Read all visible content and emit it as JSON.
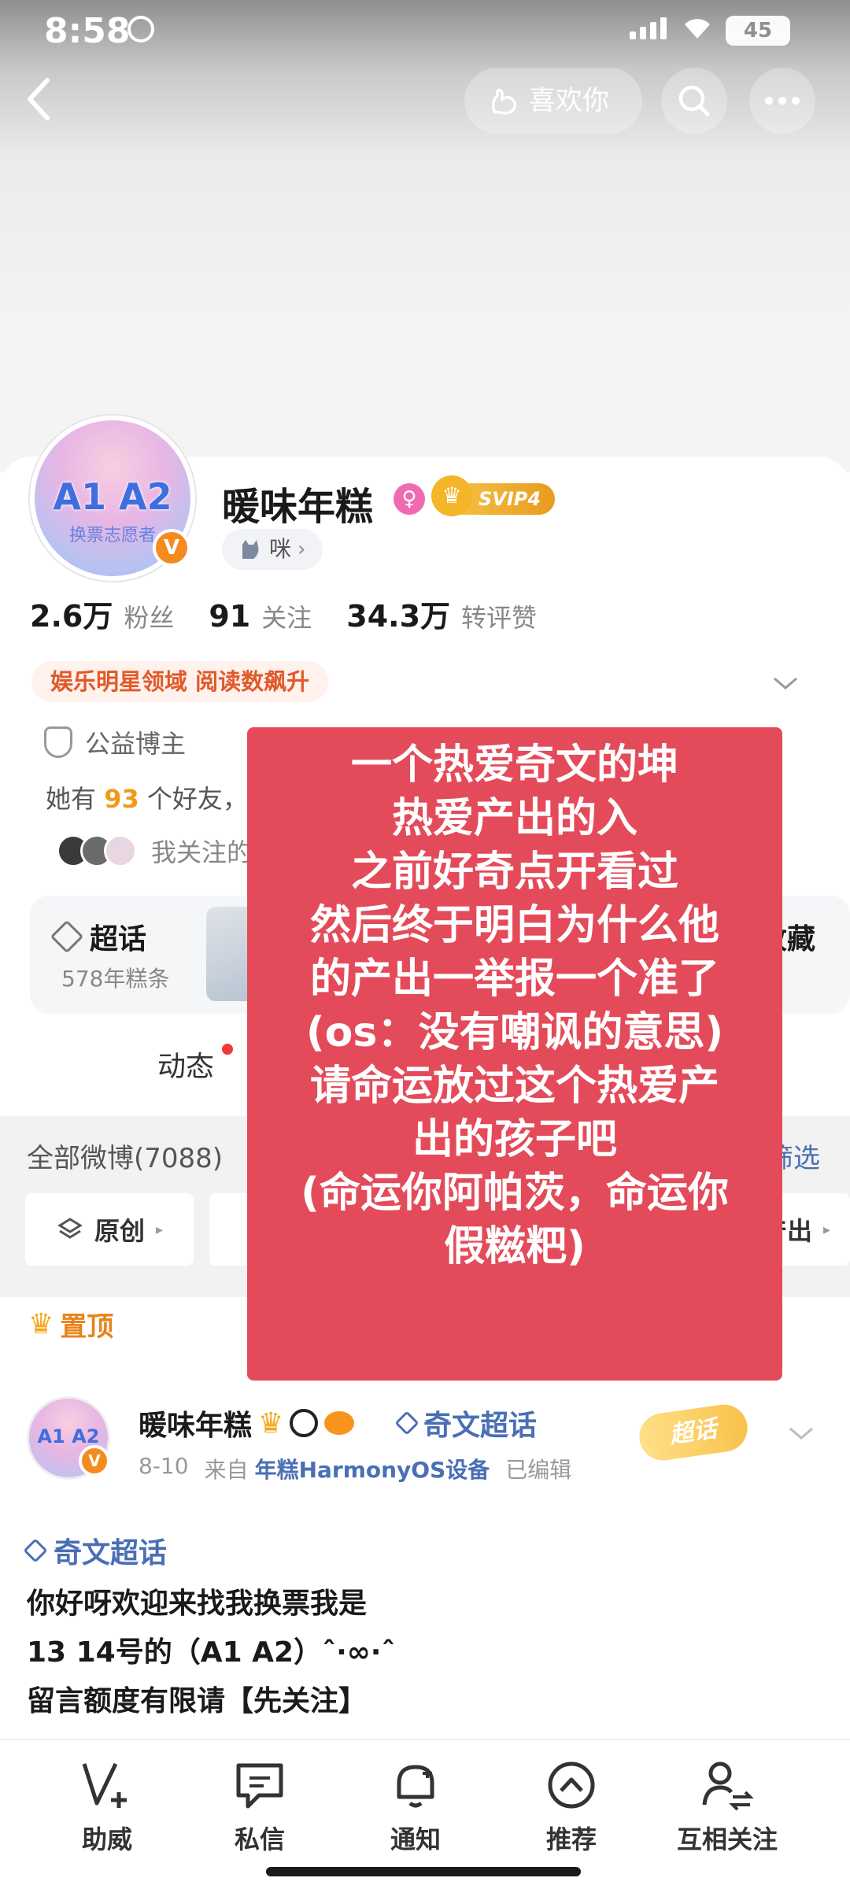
{
  "status": {
    "time": "8:58",
    "battery": "45"
  },
  "header": {
    "like_label": "喜欢你"
  },
  "profile": {
    "avatar_text": "A1 A2",
    "avatar_sub": "换票志愿者",
    "name": "暖味年糕",
    "svip": "SVIP4",
    "mimi": "咪",
    "stats": [
      {
        "num": "2.6万",
        "label": "粉丝"
      },
      {
        "num": "91",
        "label": "关注"
      },
      {
        "num": "34.3万",
        "label": "转评赞"
      }
    ],
    "tag": "娱乐明星领域 阅读数飙升",
    "public_label": "公益博主",
    "friends_prefix": "她有",
    "friends_count": "93",
    "friends_suffix": "个好友，",
    "following_label": "我关注的",
    "chaohua_title": "超话",
    "chaohua_sub": "578年糕条",
    "collect": "收藏",
    "tab_dynamic": "动态"
  },
  "filter": {
    "all_weibo": "全部微博(7088)",
    "filter_label": "筛选",
    "chip_original": "原创",
    "chip_output": "产出"
  },
  "pinned": "置顶",
  "post": {
    "author": "暖味年糕",
    "topic": "奇文超话",
    "date": "8-10",
    "from": "来自",
    "source": "年糕HarmonyOS设备",
    "edited": "已编辑",
    "badge": "超话",
    "link": "奇文超话",
    "lines": [
      "你好呀欢迎来找我换票我是",
      "13 14号的（A1 A2）ˆ·∞·ˆ",
      "留言额度有限请【先关注】"
    ]
  },
  "overlay": {
    "lines": [
      "一个热爱奇文的坤",
      "热爱产出的入",
      "之前好奇点开看过",
      "然后终于明白为什么他",
      "的产出一举报一个准了",
      "(os：没有嘲讽的意思)",
      "请命运放过这个热爱产",
      "出的孩子吧",
      "(命运你阿帕茨，命运你",
      "假糍粑)"
    ]
  },
  "nav": [
    {
      "label": "助威",
      "icon": "cheer-icon"
    },
    {
      "label": "私信",
      "icon": "message-icon"
    },
    {
      "label": "通知",
      "icon": "bell-icon"
    },
    {
      "label": "推荐",
      "icon": "recommend-icon"
    },
    {
      "label": "互相关注",
      "icon": "mutual-follow-icon"
    }
  ]
}
